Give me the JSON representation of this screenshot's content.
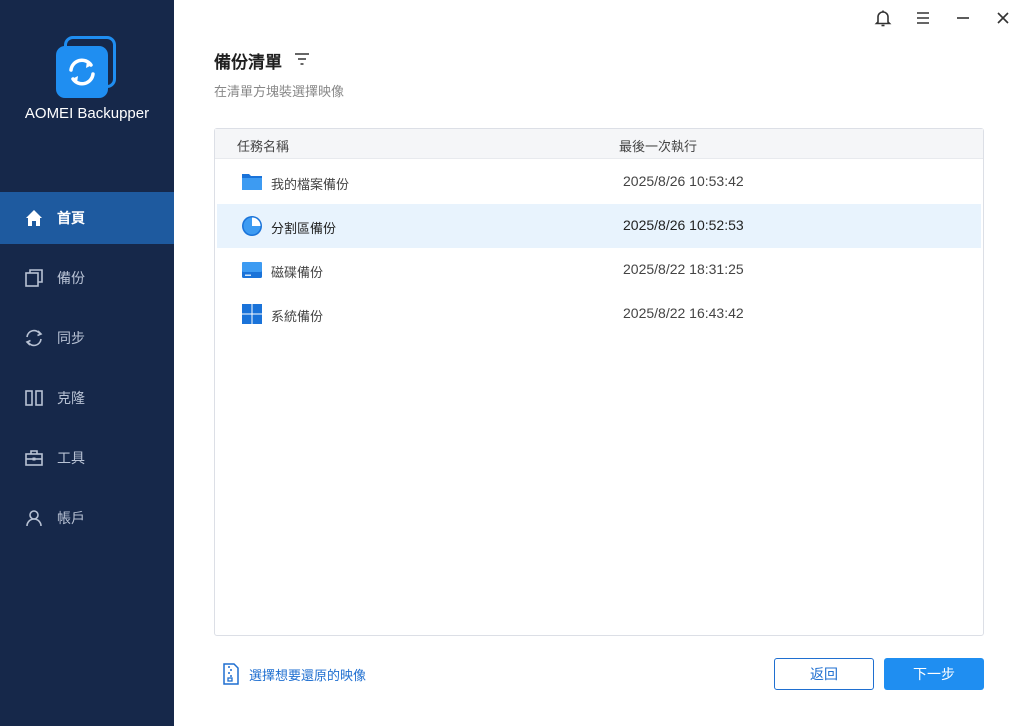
{
  "app": {
    "name": "AOMEI Backupper"
  },
  "colors": {
    "sidebar_bg": "#16284a",
    "active_nav": "#1e5a9f",
    "accent": "#1f8ef1",
    "link": "#1f6fd0",
    "selected_row": "#e8f3fd"
  },
  "sidebar": {
    "items": [
      {
        "label": "首頁",
        "icon": "home-icon",
        "active": true
      },
      {
        "label": "備份",
        "icon": "backup-icon"
      },
      {
        "label": "同步",
        "icon": "sync-icon"
      },
      {
        "label": "克隆",
        "icon": "clone-icon"
      },
      {
        "label": "工具",
        "icon": "toolbox-icon"
      },
      {
        "label": "帳戶",
        "icon": "user-icon"
      }
    ]
  },
  "window_controls": [
    "bell-icon",
    "menu-icon",
    "minimize-icon",
    "close-icon"
  ],
  "page": {
    "title": "備份清單",
    "subtitle": "在清單方塊裝選擇映像"
  },
  "table": {
    "columns": [
      "任務名稱",
      "最後一次執行"
    ],
    "rows": [
      {
        "name": "我的檔案備份",
        "time": "2025/8/26 10:53:42",
        "icon": "folder-icon"
      },
      {
        "name": "分割區備份",
        "time": "2025/8/26 10:52:53",
        "icon": "partition-icon",
        "selected": true
      },
      {
        "name": "磁碟備份",
        "time": "2025/8/22 18:31:25",
        "icon": "disk-icon"
      },
      {
        "name": "系統備份",
        "time": "2025/8/22 16:43:42",
        "icon": "windows-icon"
      }
    ]
  },
  "footer": {
    "restore_link": "選擇想要還原的映像",
    "back_button": "返回",
    "next_button": "下一步"
  }
}
